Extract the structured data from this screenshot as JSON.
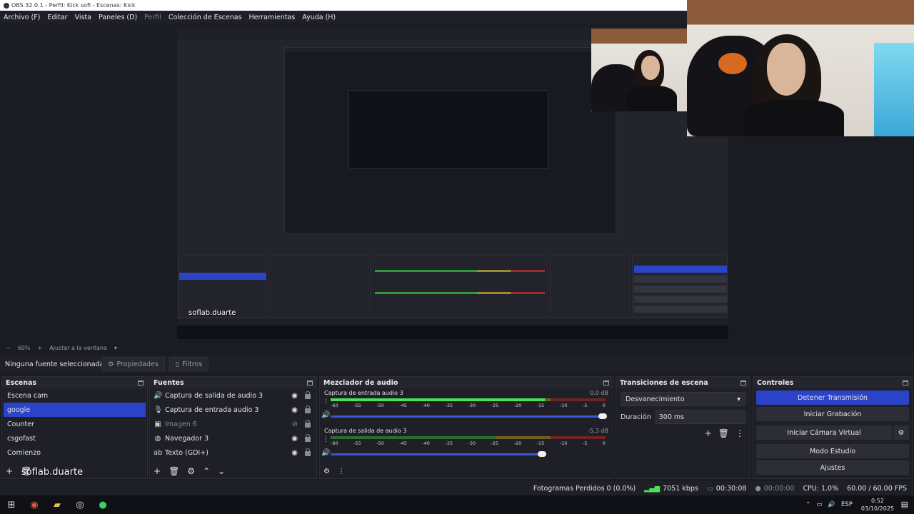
{
  "window": {
    "title": "OBS 32.0.1 - Perfil: Kick sofi - Escenas: Kick"
  },
  "menu": [
    {
      "label": "Archivo (F)",
      "disabled": false
    },
    {
      "label": "Editar",
      "disabled": false
    },
    {
      "label": "Vista",
      "disabled": false
    },
    {
      "label": "Paneles (D)",
      "disabled": false
    },
    {
      "label": "Perfil",
      "disabled": true
    },
    {
      "label": "Colección de Escenas",
      "disabled": false
    },
    {
      "label": "Herramientas",
      "disabled": false
    },
    {
      "label": "Ayuda (H)",
      "disabled": false
    }
  ],
  "preview": {
    "zoom": "60%",
    "fit_label": "Ajustar a la ventana"
  },
  "source_toolbar": {
    "no_selection": "Ninguna fuente seleccionada",
    "properties": "Propiedades",
    "filters": "Filtros"
  },
  "scenes": {
    "title": "Escenas",
    "items": [
      "Escena cam",
      "google",
      "Counter",
      "csgofast",
      "Comienzo"
    ],
    "selected": "google"
  },
  "sources": {
    "title": "Fuentes",
    "items": [
      {
        "label": "Captura de salida de audio 3",
        "icon": "speaker-icon",
        "visible": true
      },
      {
        "label": "Captura de entrada audio 3",
        "icon": "mic-icon",
        "visible": true
      },
      {
        "label": "Imagen 6",
        "icon": "image-icon",
        "visible": false
      },
      {
        "label": "Navegador 3",
        "icon": "globe-icon",
        "visible": true
      },
      {
        "label": "Texto (GDI+)",
        "icon": "text-icon",
        "visible": true
      }
    ]
  },
  "mixer": {
    "title": "Mezclador de audio",
    "ticks": [
      "-60",
      "-55",
      "-50",
      "-45",
      "-40",
      "-35",
      "-30",
      "-25",
      "-20",
      "-15",
      "-10",
      "-5",
      "0"
    ],
    "channels": [
      {
        "name": "Captura de entrada audio 3",
        "db": "0.0 dB",
        "level": 0.78,
        "volume": 1.0
      },
      {
        "name": "Captura de salida de audio 3",
        "db": "-5.3 dB",
        "level": 0.0,
        "volume": 0.78
      }
    ]
  },
  "transitions": {
    "title": "Transiciones de escena",
    "selected": "Desvanecimiento",
    "duration_label": "Duración",
    "duration_value": "300 ms"
  },
  "controls": {
    "title": "Controles",
    "buttons": [
      {
        "label": "Detener Transmisión",
        "active": true
      },
      {
        "label": "Iniciar Grabación",
        "active": false
      },
      {
        "label": "Iniciar Cámara Virtual",
        "active": false
      },
      {
        "label": "Modo Estudio",
        "active": false
      },
      {
        "label": "Ajustes",
        "active": false
      }
    ]
  },
  "status": {
    "dropped_frames": "Fotogramas Perdidos 0 (0.0%)",
    "bitrate": "7051 kbps",
    "stream_time": "00:30:08",
    "rec_time": "00:00:00",
    "cpu": "CPU: 1.0%",
    "fps": "60.00 / 60.00 FPS"
  },
  "taskbar": {
    "language": "ESP",
    "time": "0:52",
    "date": "03/10/2025"
  },
  "overlay": {
    "text": "soflab.duarte"
  },
  "colors": {
    "accent": "#2b43c6",
    "panel": "#1f2027",
    "background": "#1b1c22"
  }
}
